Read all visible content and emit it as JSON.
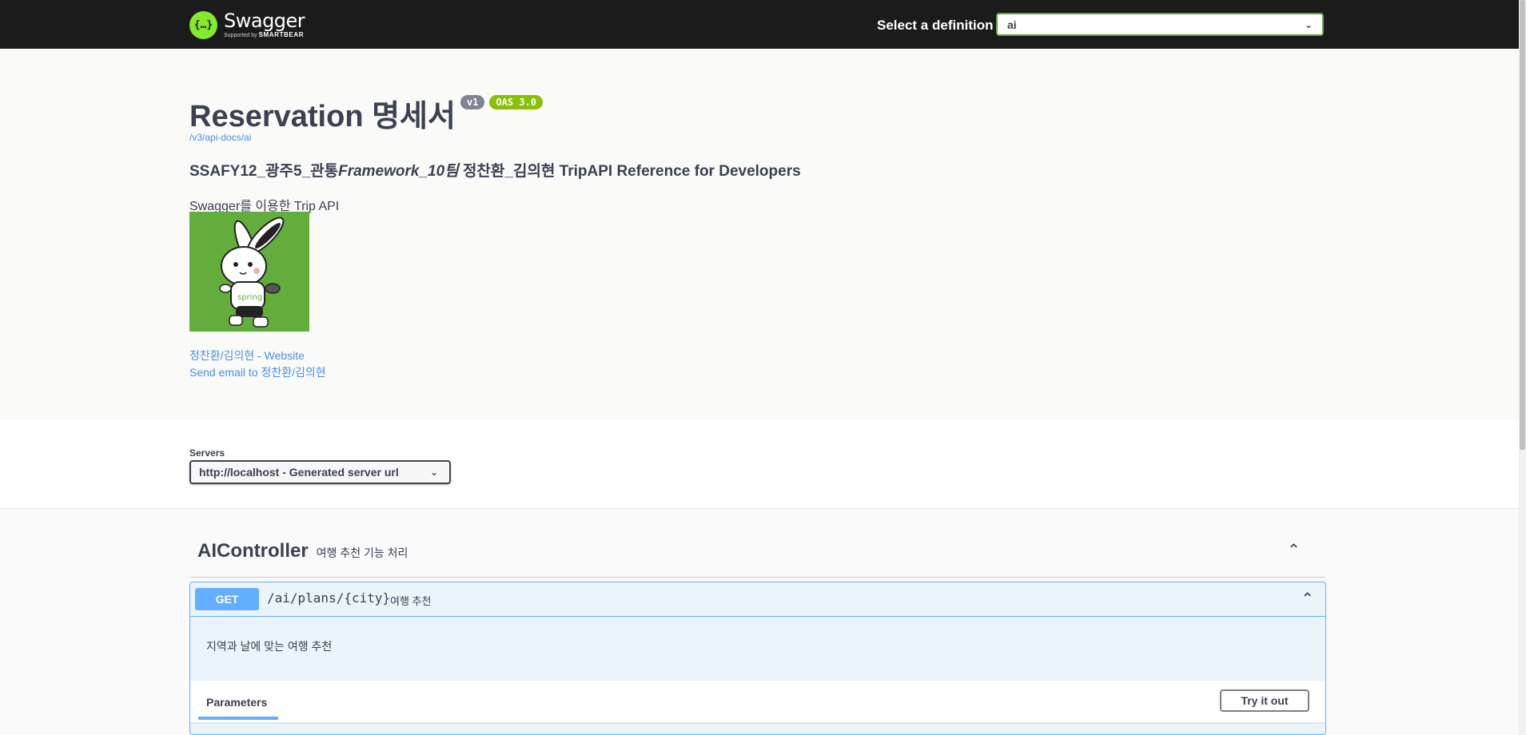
{
  "topbar": {
    "logo_name": "Swagger",
    "logo_sub_prefix": "Supported by",
    "logo_sub_brand": "SMARTBEAR",
    "logo_mark": "{…}",
    "definition_label": "Select a definition",
    "definition_value": "ai"
  },
  "info": {
    "title": "Reservation 명세서",
    "version_badge": "v1",
    "oas_badge": "OAS 3.0",
    "api_docs_url": "/v3/api-docs/ai",
    "description_title_pre": "SSAFY12_광주5_관통",
    "description_title_italic": "Framework_10팀",
    "description_title_post": " 정찬환_김의현 TripAPI Reference for Developers",
    "description_text": "Swagger를 이용한 Trip API",
    "contact_website": "정찬환/김의현 - Website",
    "contact_email": "Send email to 정찬환/김의현"
  },
  "servers": {
    "label": "Servers",
    "selected": "http://localhost - Generated server url"
  },
  "tag": {
    "name": "AIController",
    "description": "여행 추천 기능 처리"
  },
  "operation": {
    "method": "GET",
    "path": "/ai/plans/{city}",
    "summary": "여행 추천",
    "description": "지역과 날에 맞는 여행 추천",
    "params_tab": "Parameters",
    "try_button": "Try it out"
  },
  "colors": {
    "topbar": "#1b1b1b",
    "logo_green": "#85ea2d",
    "get_blue": "#61affe",
    "oas_green": "#89bf04",
    "link_blue": "#4990e2"
  }
}
